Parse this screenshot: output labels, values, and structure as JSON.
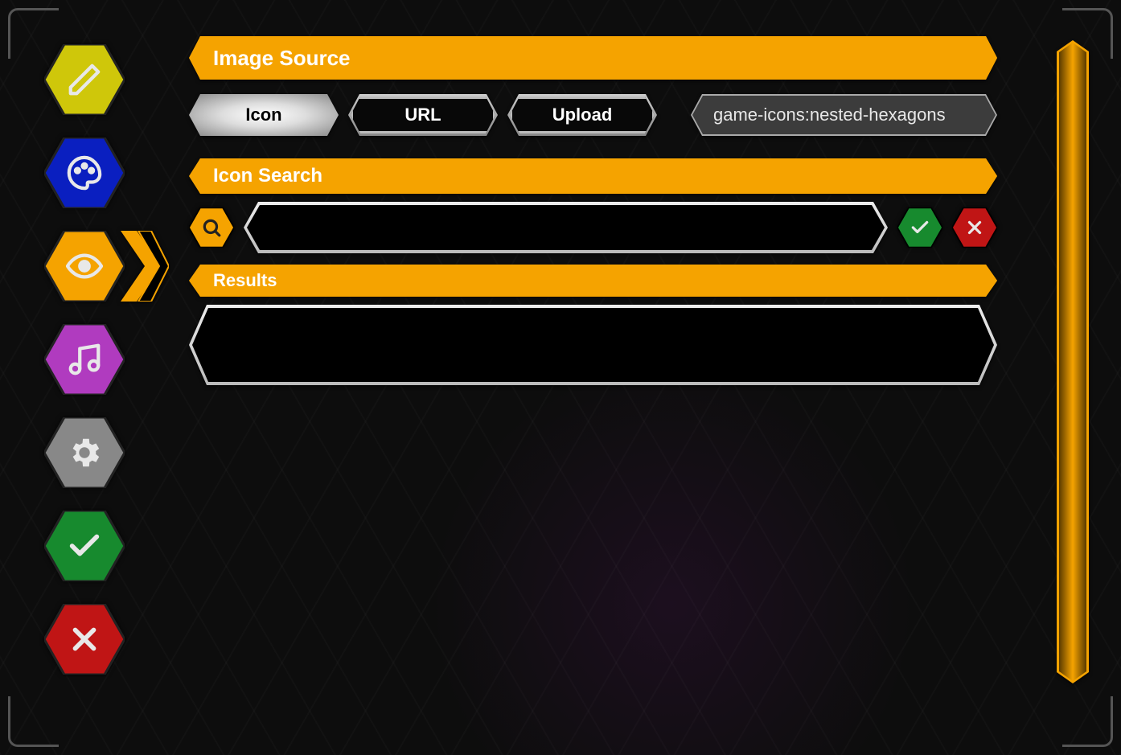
{
  "colors": {
    "accent": "#f5a300",
    "yellow": "#cfc70a",
    "blue": "#0a1fc0",
    "orange": "#f5a300",
    "purple": "#b03bbf",
    "gray": "#888888",
    "green": "#178a2e",
    "red": "#c01515"
  },
  "sidebar": {
    "items": [
      {
        "name": "edit",
        "icon": "pencil-icon",
        "color": "yellow",
        "selected": false
      },
      {
        "name": "palette",
        "icon": "palette-icon",
        "color": "blue",
        "selected": false
      },
      {
        "name": "view",
        "icon": "eye-icon",
        "color": "orange",
        "selected": true
      },
      {
        "name": "audio",
        "icon": "music-icon",
        "color": "purple",
        "selected": false
      },
      {
        "name": "settings",
        "icon": "gear-icon",
        "color": "gray",
        "selected": false
      },
      {
        "name": "confirm",
        "icon": "check-icon",
        "color": "green",
        "selected": false
      },
      {
        "name": "cancel",
        "icon": "close-icon",
        "color": "red",
        "selected": false
      }
    ]
  },
  "sections": {
    "image_source": {
      "title": "Image Source",
      "tabs": [
        {
          "key": "icon",
          "label": "Icon",
          "active": true
        },
        {
          "key": "url",
          "label": "URL",
          "active": false
        },
        {
          "key": "upload",
          "label": "Upload",
          "active": false
        }
      ],
      "value": "game-icons:nested-hexagons"
    },
    "icon_search": {
      "title": "Icon Search",
      "search_value": "",
      "search_placeholder": ""
    },
    "results": {
      "title": "Results"
    }
  },
  "actions": {
    "search": {
      "icon": "search-icon",
      "color": "orange"
    },
    "accept": {
      "icon": "check-icon",
      "color": "green"
    },
    "reject": {
      "icon": "close-icon",
      "color": "red"
    }
  }
}
